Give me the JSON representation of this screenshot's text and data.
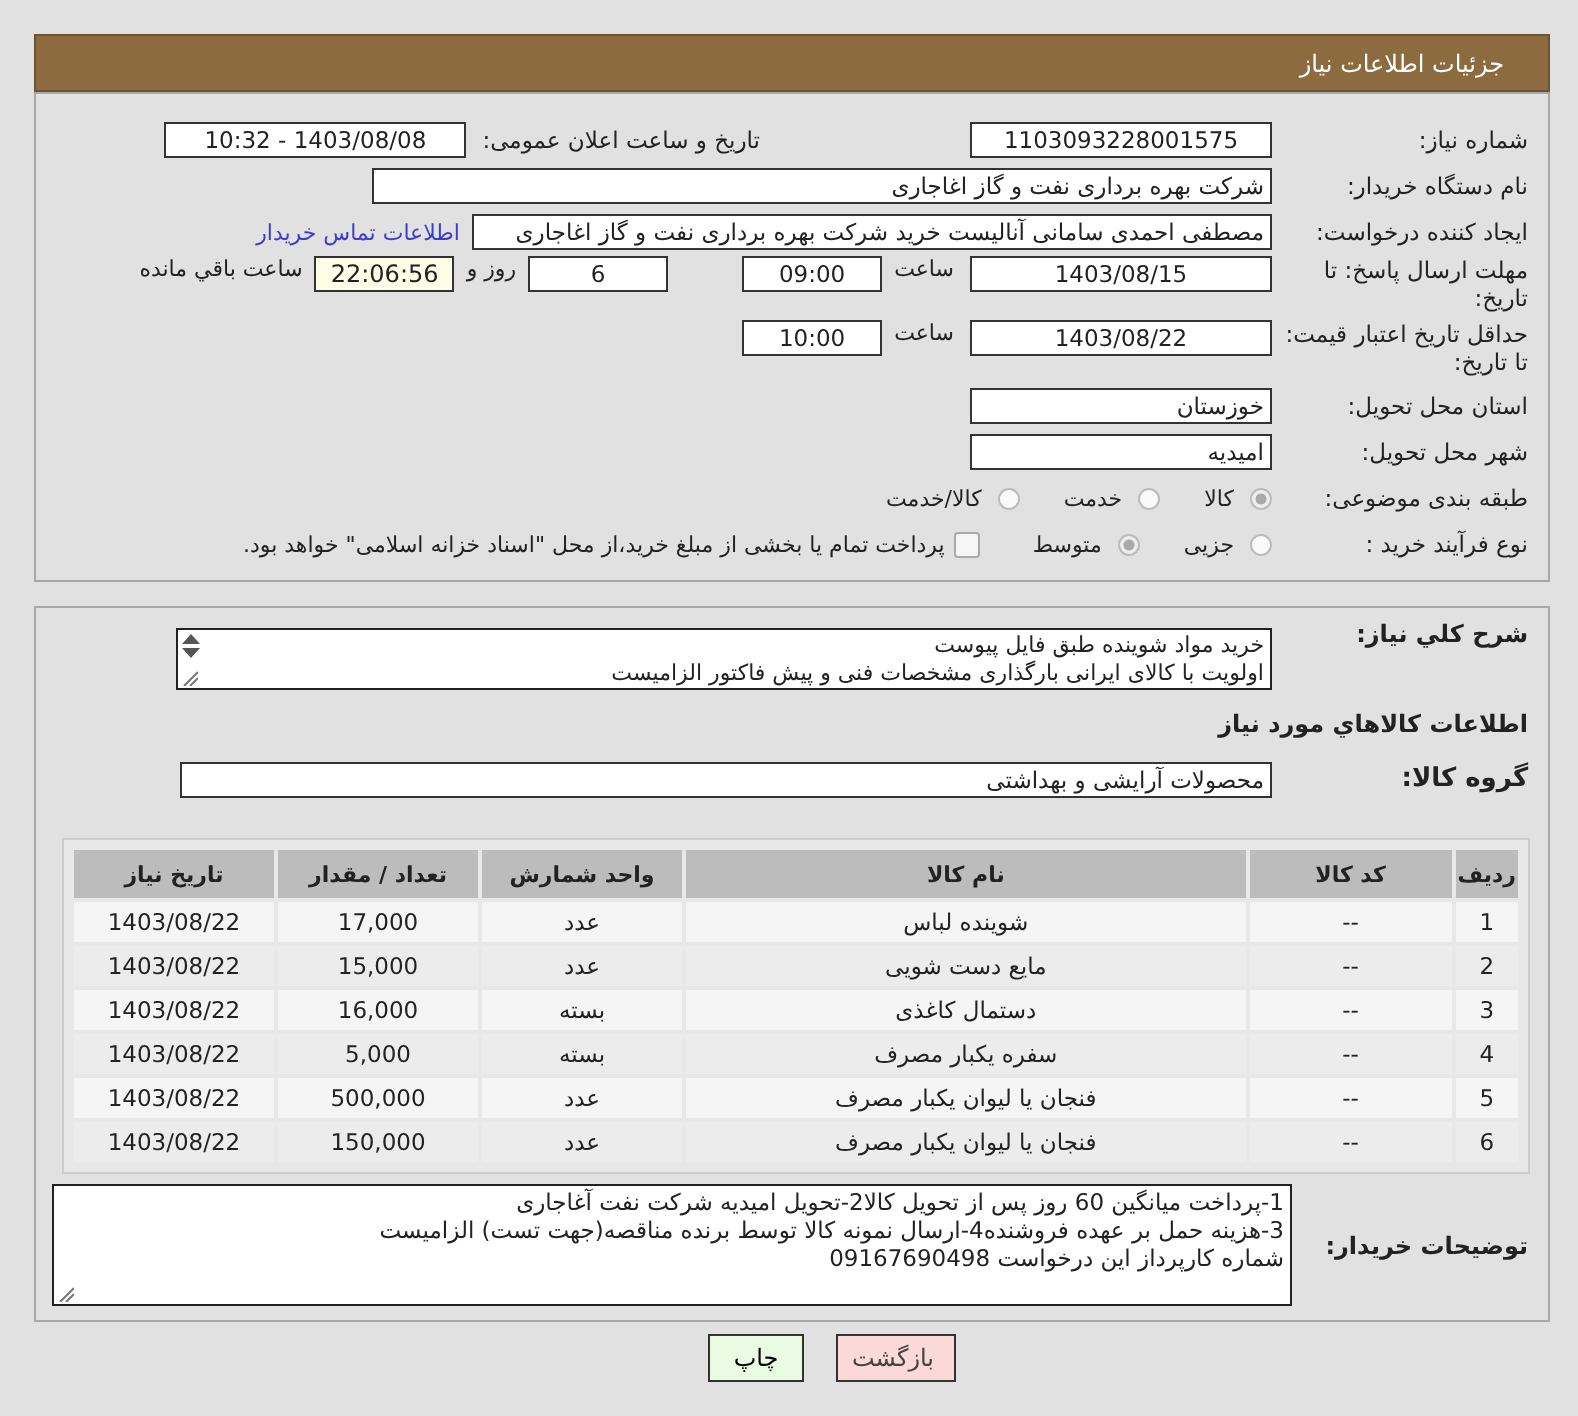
{
  "header": {
    "title": "جزئیات اطلاعات نیاز"
  },
  "need_number": {
    "label": "شماره نیاز:",
    "value": "1103093228001575"
  },
  "announce": {
    "label": "تاریخ و ساعت اعلان عمومی:",
    "value": "1403/08/08 - 10:32"
  },
  "buyer": {
    "label": "نام دستگاه خریدار:",
    "value": "شرکت بهره برداری نفت و گاز اغاجاری"
  },
  "requester": {
    "label": "ایجاد کننده درخواست:",
    "value": "مصطفی احمدی سامانی آنالیست خرید شرکت بهره برداری نفت و گاز اغاجاری",
    "link": "اطلاعات تماس خریدار"
  },
  "deadline": {
    "label": "مهلت ارسال پاسخ: تا تاریخ:",
    "date": "1403/08/15",
    "time_label": "ساعت",
    "time": "09:00",
    "days": "6",
    "days_label": "روز و",
    "remaining": "22:06:56",
    "remaining_label": "ساعت باقي مانده"
  },
  "validity": {
    "label": "حداقل تاریخ اعتبار قیمت: تا تاریخ:",
    "date": "1403/08/22",
    "time_label": "ساعت",
    "time": "10:00"
  },
  "province": {
    "label": "استان محل تحویل:",
    "value": "خوزستان"
  },
  "city": {
    "label": "شهر محل تحویل:",
    "value": "امیدیه"
  },
  "category": {
    "label": "طبقه بندی موضوعی:",
    "options": [
      {
        "label": "کالا",
        "selected": true
      },
      {
        "label": "خدمت",
        "selected": false
      },
      {
        "label": "کالا/خدمت",
        "selected": false
      }
    ]
  },
  "process": {
    "label": "نوع فرآیند خرید :",
    "options": [
      {
        "label": "جزیی",
        "selected": false
      },
      {
        "label": "متوسط",
        "selected": true
      }
    ],
    "treasury": {
      "label": "پرداخت تمام یا بخشی از مبلغ خرید،از محل \"اسناد خزانه اسلامی\" خواهد بود.",
      "checked": false
    }
  },
  "description": {
    "label": "شرح کلي نیاز:",
    "lines": [
      "خرید مواد شوینده طبق فایل پیوست",
      "اولویت با کالای ایرانی بارگذاری مشخصات فنی و پیش فاکتور الزامیست"
    ]
  },
  "goods_heading": "اطلاعات کالاهاي مورد نیاز",
  "goods_group": {
    "label": "گروه کالا:",
    "value": "محصولات آرایشی و بهداشتی"
  },
  "table": {
    "columns": [
      "ردیف",
      "کد کالا",
      "نام کالا",
      "واحد شمارش",
      "تعداد / مقدار",
      "تاریخ نیاز"
    ],
    "rows": [
      [
        "1",
        "--",
        "شوینده لباس",
        "عدد",
        "17,000",
        "1403/08/22"
      ],
      [
        "2",
        "--",
        "مایع دست شویی",
        "عدد",
        "15,000",
        "1403/08/22"
      ],
      [
        "3",
        "--",
        "دستمال کاغذی",
        "بسته",
        "16,000",
        "1403/08/22"
      ],
      [
        "4",
        "--",
        "سفره یکبار مصرف",
        "بسته",
        "5,000",
        "1403/08/22"
      ],
      [
        "5",
        "--",
        "فنجان یا لیوان یکبار مصرف",
        "عدد",
        "500,000",
        "1403/08/22"
      ],
      [
        "6",
        "--",
        "فنجان یا لیوان یکبار مصرف",
        "عدد",
        "150,000",
        "1403/08/22"
      ]
    ]
  },
  "buyer_notes": {
    "label": "توضیحات خریدار:",
    "lines": [
      "1-پرداخت میانگین 60 روز پس از تحویل کالا2-تحویل امیدیه شرکت نفت آغاجاری",
      "3-هزینه حمل بر عهده فروشنده4-ارسال نمونه کالا توسط برنده مناقصه(جهت تست) الزامیست",
      "شماره کارپرداز این درخواست 09167690498"
    ]
  },
  "buttons": [
    {
      "label": "بازگشت",
      "kind": "back"
    },
    {
      "label": "چاپ",
      "kind": "print"
    }
  ]
}
